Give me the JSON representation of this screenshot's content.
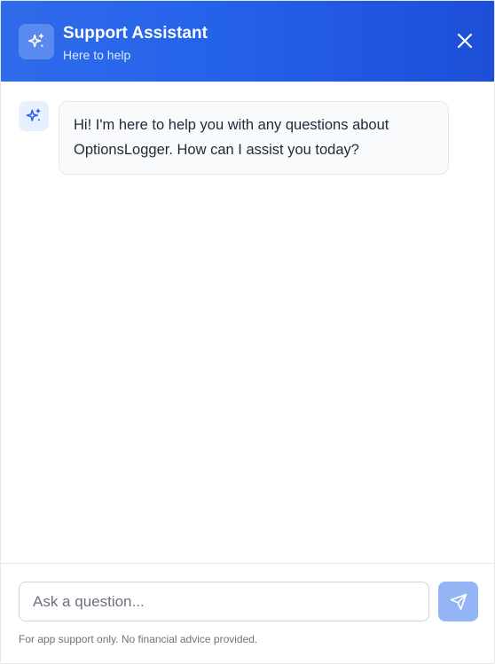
{
  "header": {
    "title": "Support Assistant",
    "subtitle": "Here to help",
    "icon": "sparkles-icon",
    "close_icon": "close-icon"
  },
  "messages": [
    {
      "sender": "assistant",
      "avatar_icon": "sparkles-icon",
      "text": "Hi! I'm here to help you with any questions about OptionsLogger. How can I assist you today?"
    }
  ],
  "composer": {
    "placeholder": "Ask a question...",
    "value": "",
    "send_icon": "send-icon",
    "disclaimer": "For app support only. No financial advice provided."
  },
  "colors": {
    "header_gradient_start": "#2f6be9",
    "header_gradient_end": "#1d4ed8",
    "accent": "#2563eb",
    "send_button_disabled": "#93b4f5"
  }
}
